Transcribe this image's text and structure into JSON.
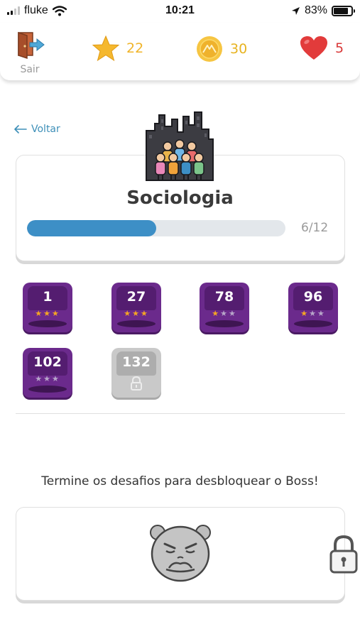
{
  "status_bar": {
    "carrier": "fluke",
    "time": "10:21",
    "battery_percent": "83%",
    "battery_level": 0.83
  },
  "header": {
    "exit_label": "Sair",
    "stars": "22",
    "coins": "30",
    "lives": "5"
  },
  "back_label": "Voltar",
  "subject": {
    "title": "Sociologia",
    "progress_text": "6/12",
    "progress_fraction": 0.5
  },
  "levels": [
    {
      "number": "1",
      "stars": 3,
      "locked": false
    },
    {
      "number": "27",
      "stars": 3,
      "locked": false
    },
    {
      "number": "78",
      "stars": 1,
      "locked": false
    },
    {
      "number": "96",
      "stars": 1,
      "locked": false
    },
    {
      "number": "102",
      "stars": 0,
      "locked": false
    },
    {
      "number": "132",
      "stars": 0,
      "locked": true
    }
  ],
  "boss": {
    "message": "Termine os desafios para desbloquear o Boss!"
  },
  "colors": {
    "accent_blue": "#3d8fc6",
    "level_purple": "#6b2a8c",
    "star_gold": "#f0b429",
    "heart_red": "#d93a3a"
  }
}
